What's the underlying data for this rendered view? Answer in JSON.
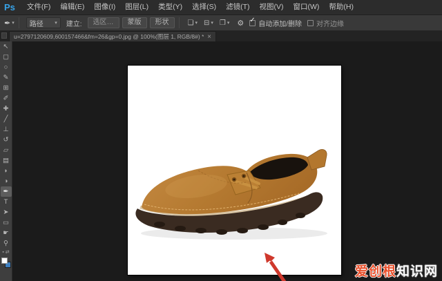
{
  "app": {
    "logo": "Ps",
    "logo_color": "#37a3e8",
    "theme": {
      "menubar_bg": "#2c2c2c",
      "optionsbar_bg": "#393939",
      "toolbar_bg": "#3e3e3e",
      "canvas_bg": "#1b1b1b"
    }
  },
  "menu_bar": {
    "items": [
      "文件(F)",
      "编辑(E)",
      "图像(I)",
      "图层(L)",
      "类型(Y)",
      "选择(S)",
      "滤镜(T)",
      "视图(V)",
      "窗口(W)",
      "帮助(H)"
    ]
  },
  "options_bar": {
    "tool_icon_glyph": "✒",
    "tool_caret": "▾",
    "mode_dropdown": {
      "value": "路径",
      "caret": "▾"
    },
    "make_label": "建立:",
    "selection_button": "选区…",
    "mask_button": "蒙版",
    "shape_button": "形状",
    "path_ops_glyph": "❏",
    "path_align_glyph": "⊟",
    "path_arrange_glyph": "❐",
    "gear_glyph": "⚙",
    "auto_add_checkbox": {
      "checked": true,
      "check_glyph": "✓",
      "label": "自动添加/删除"
    },
    "align_edges_checkbox": {
      "checked": false,
      "label": "对齐边缘"
    }
  },
  "tab_bar": {
    "tabs": [
      {
        "title": "u=2797120609,600157466&fm=26&gp=0.jpg @ 100%(图层 1, RGB/8#) *",
        "close_glyph": "×"
      }
    ]
  },
  "toolbar": {
    "tools": [
      {
        "name": "move-tool",
        "glyph": "↖"
      },
      {
        "name": "marquee-tool",
        "glyph": "▢"
      },
      {
        "name": "lasso-tool",
        "glyph": "○"
      },
      {
        "name": "quick-selection-tool",
        "glyph": "✎"
      },
      {
        "name": "crop-tool",
        "glyph": "⊞"
      },
      {
        "name": "eyedropper-tool",
        "glyph": "✐"
      },
      {
        "name": "healing-brush-tool",
        "glyph": "✚"
      },
      {
        "name": "brush-tool",
        "glyph": "╱"
      },
      {
        "name": "clone-stamp-tool",
        "glyph": "⊥"
      },
      {
        "name": "history-brush-tool",
        "glyph": "↺"
      },
      {
        "name": "eraser-tool",
        "glyph": "▱"
      },
      {
        "name": "gradient-tool",
        "glyph": "▤"
      },
      {
        "name": "blur-tool",
        "glyph": "◗"
      },
      {
        "name": "dodge-tool",
        "glyph": "◑"
      },
      {
        "name": "pen-tool",
        "glyph": "✒",
        "selected": true
      },
      {
        "name": "type-tool",
        "glyph": "T"
      },
      {
        "name": "path-selection-tool",
        "glyph": "➤"
      },
      {
        "name": "shape-tool",
        "glyph": "▭"
      },
      {
        "name": "hand-tool",
        "glyph": "☛"
      },
      {
        "name": "zoom-tool",
        "glyph": "⚲"
      }
    ],
    "mini": {
      "default_swatches_glyph": "▪",
      "swap_swatches_glyph": "⇄"
    },
    "swatches": {
      "foreground": "#ffffff",
      "background": "#3e7fbf"
    }
  },
  "canvas": {
    "zoom_percent": "100%",
    "document_background": "#ffffff",
    "annotation_arrow_color": "#cf382c",
    "shoe_colors": {
      "upper": "#c58a42",
      "upper_dark": "#a86c28",
      "sole": "#3a2b21",
      "tread": "#251a12",
      "collar": "#18120d",
      "stitch": "#e2b26e",
      "laces": "#c89040",
      "welt": "#d8c5a5"
    }
  },
  "watermark": {
    "red_text": "爱创根",
    "white_text": "知识网",
    "red_color": "#e8512d"
  }
}
